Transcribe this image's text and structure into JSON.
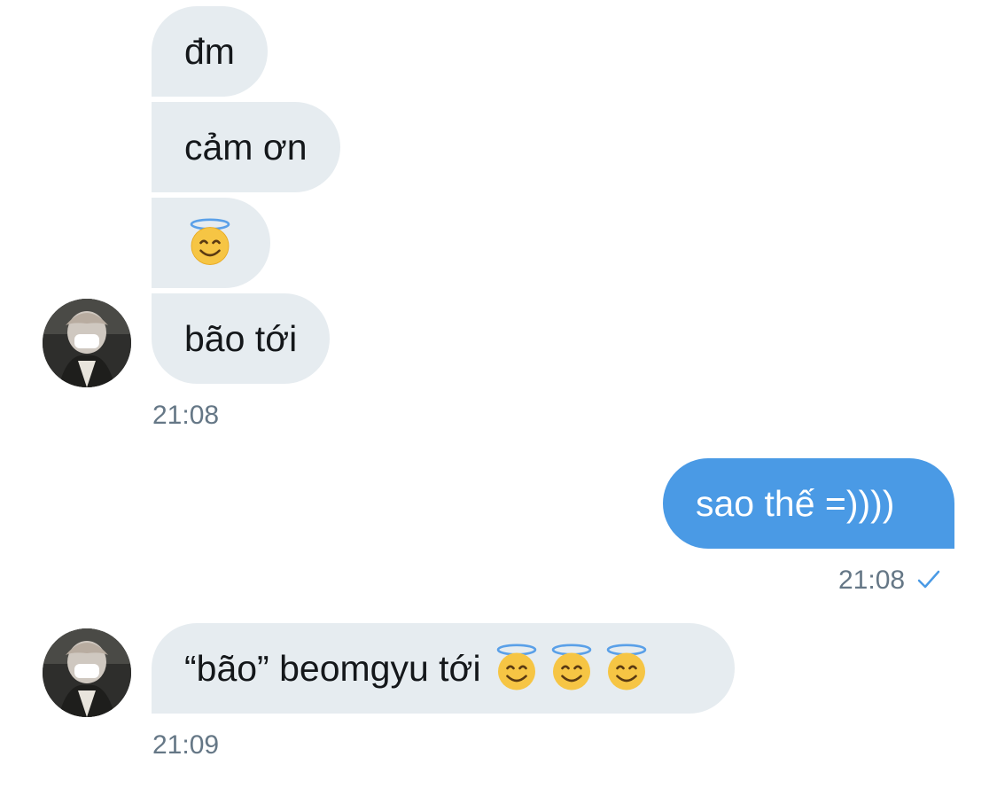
{
  "conversation": {
    "group1": {
      "messages": [
        {
          "text": "đm"
        },
        {
          "text": "cảm ơn"
        },
        {
          "emoji": "smiling-face-with-halo"
        },
        {
          "text": "bão tới"
        }
      ],
      "timestamp": "21:08"
    },
    "outgoing": {
      "text": "sao thế =))))",
      "timestamp": "21:08",
      "status_icon": "checkmark-icon"
    },
    "group2": {
      "text": "“bão” beomgyu tới",
      "emojis": [
        "smiling-face-with-halo",
        "smiling-face-with-halo",
        "smiling-face-with-halo"
      ],
      "timestamp": "21:09"
    }
  },
  "colors": {
    "incoming_bubble": "#e6ecf0",
    "outgoing_bubble": "#4a9ae5",
    "timestamp": "#657786",
    "checkmark": "#4a9ae5"
  }
}
